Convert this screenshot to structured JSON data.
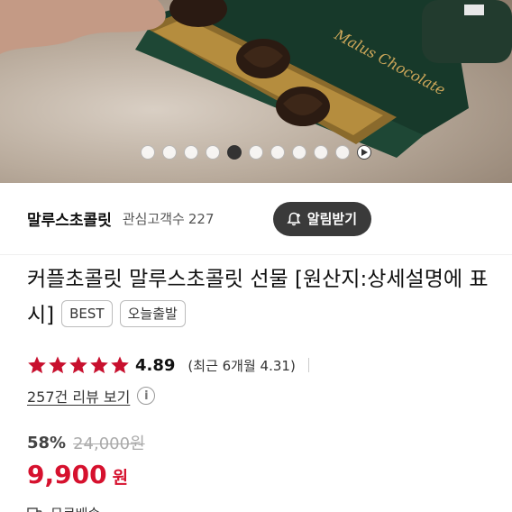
{
  "gallery": {
    "slide_count": 11,
    "active_index": 4,
    "play_index": 10,
    "box_brand": "Malus Chocolate"
  },
  "seller": {
    "name": "말루스초콜릿",
    "watch_label": "관심고객수",
    "watch_count": "227",
    "alarm_button": "알림받기"
  },
  "product": {
    "title": "커플초콜릿 말루스초콜릿 선물 [원산지:상세설명에 표시]",
    "badges": [
      "BEST",
      "오늘출발"
    ]
  },
  "rating": {
    "stars": 5,
    "score": "4.89",
    "recent": "(최근 6개월 4.31)",
    "review_link": "257건 리뷰 보기",
    "star_color": "#c8102e"
  },
  "price": {
    "discount": "58%",
    "original": "24,000원",
    "sale": "9,900",
    "currency": "원",
    "accent": "#d6112e"
  },
  "shipping": {
    "text": "무료배송"
  }
}
